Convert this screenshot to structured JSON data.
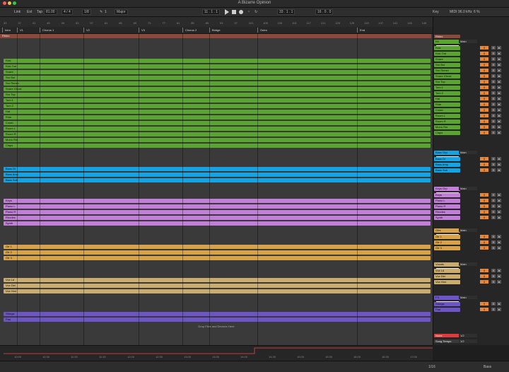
{
  "window": {
    "title": "A Bizarre Opinion"
  },
  "transport": {
    "link": "Link",
    "ext": "Ext",
    "tap": "Tap",
    "tempo": "81.00",
    "sig": "4 / 4",
    "quant": "1/8",
    "pencil": "1",
    "mode": "Major",
    "bar": "11 . 1 . 1",
    "loop_start": "33 . 1 . 1",
    "loop_len": "16 . 0 . 0",
    "key": "Key",
    "midi": "MIDI",
    "cpu": "96.0 kHz",
    "pct": "6 %"
  },
  "ruler": {
    "ticks": [
      "33",
      "37",
      "41",
      "45",
      "49",
      "53",
      "57",
      "61",
      "65",
      "69",
      "73",
      "77",
      "81",
      "85",
      "89",
      "93",
      "97",
      "101",
      "105",
      "109",
      "113",
      "117",
      "121",
      "125",
      "129",
      "133",
      "137",
      "141",
      "145",
      "149"
    ]
  },
  "markers": [
    {
      "label": "Intro"
    },
    {
      "label": "V1"
    },
    {
      "label": "Chorus 1"
    },
    {
      "label": "V2"
    },
    {
      "label": "V3"
    },
    {
      "label": "Chorus 2"
    },
    {
      "label": "Bridge"
    },
    {
      "label": "Outro"
    },
    {
      "label": "End"
    }
  ],
  "colors": {
    "green": "#5aa52f",
    "blue": "#16a3e3",
    "purple": "#c27ed8",
    "orange": "#d7a34a",
    "tan": "#c9ac6e",
    "indigo": "#6e55c7",
    "accent": "#e8873a"
  },
  "clip_labels": {
    "green": [
      "Kick",
      "Kick Out",
      "Snare",
      "Snr Bot",
      "Snr Rimsh",
      "Snare Ghost",
      "Snr Top",
      "Tom 1",
      "Tom 2",
      "Hat",
      "Ride",
      "Crash",
      "Room L",
      "Room R",
      "Mono Rm",
      "Claps"
    ],
    "blue": [
      "Bass DI",
      "Bass Amp",
      "Bass Sub"
    ],
    "purple": [
      "Keys",
      "Piano L",
      "Piano R",
      "Rhodes",
      "Synth"
    ],
    "orange": [
      "Gtr 1",
      "Gtr 2",
      "Gtr 3"
    ],
    "tan": [
      "Vox Ld",
      "Vox Dbl",
      "Vox Hrm"
    ],
    "indigo": [
      "Strings",
      "Pad"
    ]
  },
  "mixer": {
    "master": "Rhino",
    "groups": [
      {
        "name": "Kit",
        "route": "Main",
        "input": "None",
        "members": [
          "Kick",
          "Kick Out",
          "Snare",
          "Snr Bot",
          "Snr Rimsh",
          "Snare Ghost",
          "Snr Top",
          "Tom 1",
          "Tom 2",
          "Hat",
          "Ride",
          "Crash",
          "Room L",
          "Room R",
          "Mono Rm",
          "Claps"
        ]
      },
      {
        "name": "Bass Grp",
        "route": "Main",
        "input": "None",
        "members": [
          "Bass DI",
          "Bass Amp",
          "Bass Sub"
        ]
      },
      {
        "name": "Keys Grp",
        "route": "Main",
        "input": "None",
        "members": [
          "Keys",
          "Piano L",
          "Piano R",
          "Rhodes",
          "Synth"
        ]
      },
      {
        "name": "Gtrs",
        "route": "Main",
        "input": "None",
        "members": [
          "Gtr 1",
          "Gtr 2",
          "Gtr 3"
        ]
      },
      {
        "name": "Vocals",
        "route": "Main",
        "input": "None",
        "members": [
          "Vox Ld",
          "Vox Dbl",
          "Vox Hrm"
        ]
      },
      {
        "name": "FX",
        "route": "Main",
        "input": "None",
        "members": [
          "Strings",
          "Pad"
        ]
      }
    ],
    "returns": [
      "None",
      "Song Tempo"
    ],
    "return_vals": [
      "1/2",
      "1/2"
    ],
    "cue": "78.0",
    "cue2": "16.0"
  },
  "drop_hint": "Drop Files and Devices Here",
  "bottom_ticks": [
    "10:00",
    "10:30",
    "11:00",
    "11:30",
    "12:00",
    "12:30",
    "13:00",
    "13:30",
    "14:00",
    "14:30",
    "15:00",
    "15:30",
    "16:00",
    "16:30",
    "17:00"
  ],
  "statusbar": {
    "zoom": "1/16",
    "track": "Bass"
  }
}
